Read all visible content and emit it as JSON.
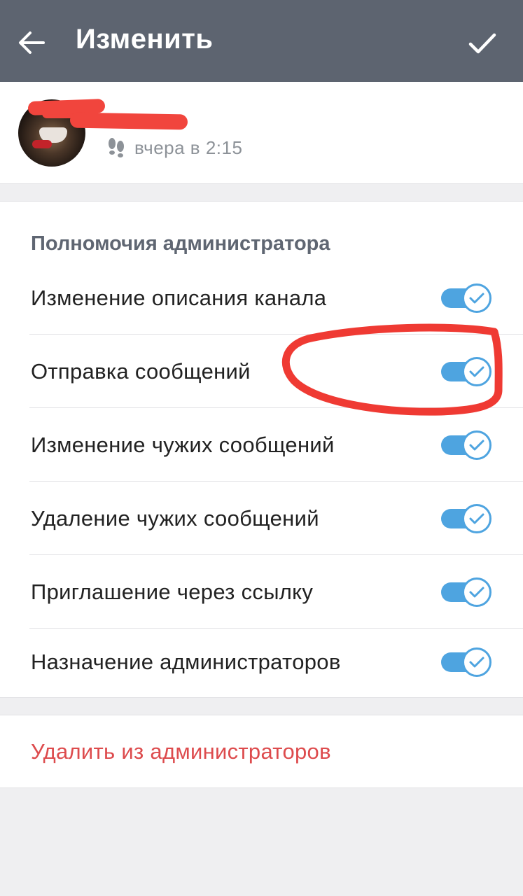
{
  "app_bar": {
    "title": "Изменить",
    "back_icon": "arrow-left-icon",
    "confirm_icon": "checkmark-icon",
    "background": "#5d6470"
  },
  "user": {
    "last_seen": "вчера в 2:15",
    "status_icon": "footprints-icon"
  },
  "permissions": {
    "section_title": "Полномочия администратора",
    "items": [
      {
        "label": "Изменение описания канала",
        "enabled": true
      },
      {
        "label": "Отправка сообщений",
        "enabled": true
      },
      {
        "label": "Изменение чужих сообщений",
        "enabled": true
      },
      {
        "label": "Удаление чужих сообщений",
        "enabled": true
      },
      {
        "label": "Приглашение через ссылку",
        "enabled": true
      },
      {
        "label": "Назначение администраторов",
        "enabled": true
      }
    ]
  },
  "remove": {
    "label": "Удалить из администраторов"
  },
  "colors": {
    "accent": "#4ea4e0",
    "danger": "#dd4b4d",
    "annotation": "#ef3a33"
  }
}
